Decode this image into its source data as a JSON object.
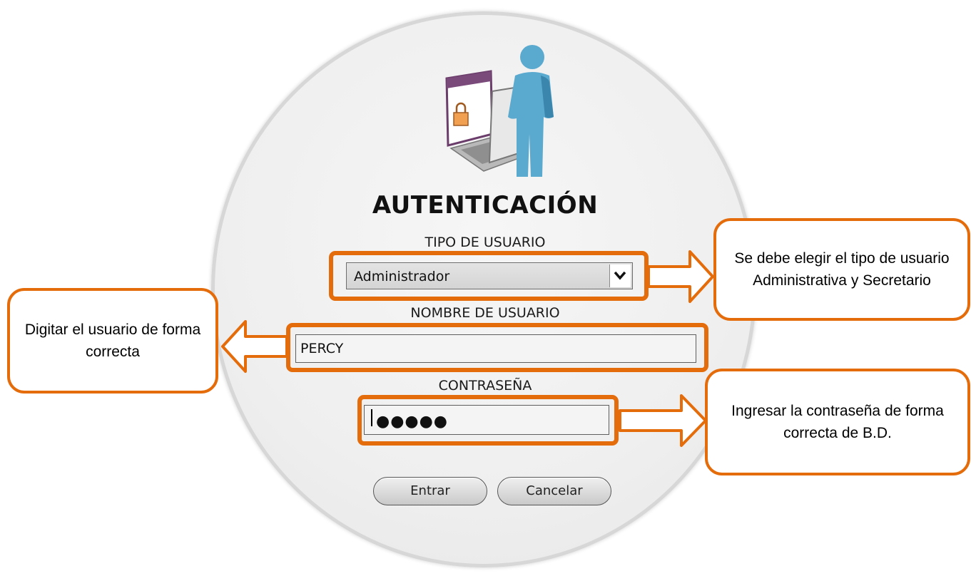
{
  "dialog": {
    "title": "AUTENTICACIÓN",
    "user_type": {
      "label": "TIPO DE USUARIO",
      "selected": "Administrador"
    },
    "username": {
      "label": "NOMBRE DE USUARIO",
      "value": "PERCY"
    },
    "password": {
      "label": "CONTRASEÑA",
      "value": "●●●●●"
    },
    "buttons": {
      "enter": "Entrar",
      "cancel": "Cancelar"
    },
    "icon": "user-with-computer-lock-icon"
  },
  "annotations": {
    "user_type_note": "Se debe elegir el tipo de usuario Administrativa y Secretario",
    "username_note": "Digitar el usuario de forma correcta",
    "password_note": "Ingresar la contraseña de forma correcta de B.D."
  },
  "colors": {
    "annotation_orange": "#e46c0a",
    "dialog_background": "#efefef",
    "person_blue": "#5aa9cf"
  }
}
